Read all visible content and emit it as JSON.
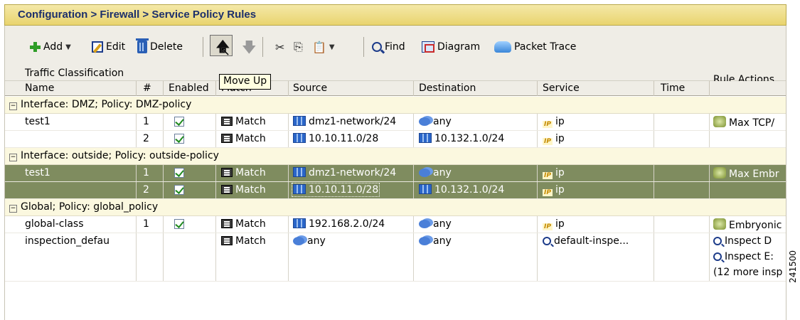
{
  "title": "Configuration > Firewall > Service Policy Rules",
  "toolbar": {
    "add": "Add",
    "edit": "Edit",
    "delete": "Delete",
    "find": "Find",
    "diagram": "Diagram",
    "packet_trace": "Packet Trace",
    "tooltip": "Move Up"
  },
  "headers": {
    "traffic_classification": "Traffic Classification",
    "name": "Name",
    "num": "#",
    "enabled": "Enabled",
    "match": "Match",
    "source": "Source",
    "destination": "Destination",
    "service": "Service",
    "time": "Time",
    "rule_actions": "Rule Actions"
  },
  "groups": [
    {
      "label": "Interface: DMZ; Policy: DMZ-policy",
      "rows": [
        {
          "name": "test1",
          "num": "1",
          "enabled": true,
          "match": "Match",
          "source": "dmz1-network/24",
          "source_icon": "net",
          "destination": "any",
          "dest_icon": "any",
          "service": "ip",
          "service_icon": "ip",
          "action": "Max TCP/",
          "action_icon": "act",
          "selected": false
        },
        {
          "name": "",
          "num": "2",
          "enabled": true,
          "match": "Match",
          "source": "10.10.11.0/28",
          "source_icon": "net",
          "destination": "10.132.1.0/24",
          "dest_icon": "net",
          "service": "ip",
          "service_icon": "ip",
          "action": "",
          "action_icon": "",
          "selected": false
        }
      ]
    },
    {
      "label": "Interface: outside; Policy: outside-policy",
      "rows": [
        {
          "name": "test1",
          "num": "1",
          "enabled": true,
          "match": "Match",
          "source": "dmz1-network/24",
          "source_icon": "net",
          "destination": "any",
          "dest_icon": "any",
          "service": "ip",
          "service_icon": "ip",
          "action": "Max Embr",
          "action_icon": "act",
          "selected": true
        },
        {
          "name": "",
          "num": "2",
          "enabled": true,
          "match": "Match",
          "source": "10.10.11.0/28",
          "source_icon": "net",
          "destination": "10.132.1.0/24",
          "dest_icon": "net",
          "service": "ip",
          "service_icon": "ip",
          "action": "",
          "action_icon": "",
          "selected": true
        }
      ]
    },
    {
      "label": "Global; Policy: global_policy",
      "rows": [
        {
          "name": "global-class",
          "num": "1",
          "enabled": true,
          "match": "Match",
          "source": "192.168.2.0/24",
          "source_icon": "net",
          "destination": "any",
          "dest_icon": "any",
          "service": "ip",
          "service_icon": "ip",
          "action": "Embryonic",
          "action_icon": "act",
          "selected": false
        },
        {
          "name": "inspection_defau",
          "num": "",
          "enabled": false,
          "match": "Match",
          "source": "any",
          "source_icon": "any",
          "destination": "any",
          "dest_icon": "any",
          "service": "default-inspe...",
          "service_icon": "insp",
          "action": "Inspect D",
          "action_icon": "insp",
          "selected": false,
          "extra_actions": [
            "Inspect E:",
            "(12 more insp"
          ]
        }
      ]
    }
  ],
  "side_code": "241500"
}
